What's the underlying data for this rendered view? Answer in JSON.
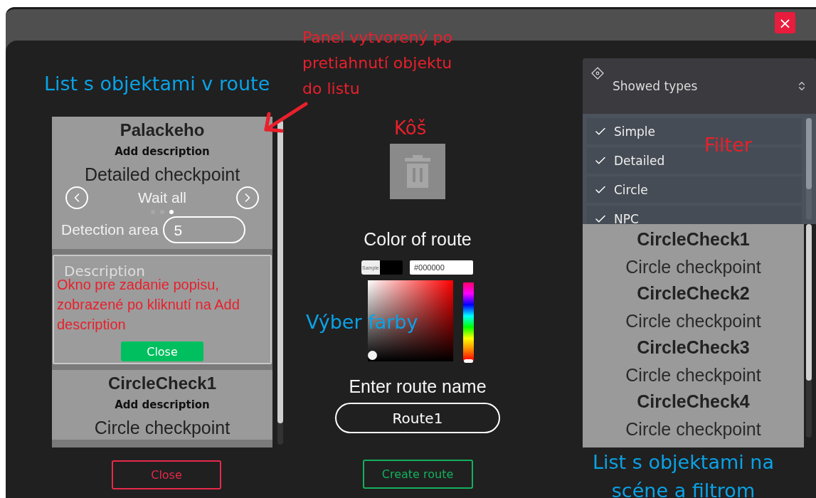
{
  "window": {
    "close_button": "×"
  },
  "route_list": {
    "items": [
      {
        "kind": "checkpoint",
        "name": "Palackeho",
        "description_link": "Add description",
        "type": "Detailed checkpoint",
        "mode": "Wait all",
        "mode_dots": [
          {
            "selected": false
          },
          {
            "selected": false
          },
          {
            "selected": true
          }
        ],
        "detection_label": "Detection area",
        "detection_value": "5"
      },
      {
        "kind": "description_editor",
        "placeholder": "Description",
        "close_button": "Close"
      },
      {
        "kind": "checkpoint",
        "name": "CircleCheck1",
        "description_link": "Add description",
        "type": "Circle checkpoint"
      }
    ],
    "close_button": "Close"
  },
  "color_picker": {
    "title": "Color of route",
    "sample_label": "Sample",
    "hex_value": "#000000",
    "hue_slider": {
      "level": 0
    }
  },
  "route_name": {
    "label": "Enter route name",
    "value": "Route1"
  },
  "create_button": "Create route",
  "filter": {
    "title": "Showed types",
    "options": [
      {
        "label": "Simple",
        "checked": true
      },
      {
        "label": "Detailed",
        "checked": true
      },
      {
        "label": "Circle",
        "checked": true
      },
      {
        "label": "NPC",
        "checked": true
      }
    ]
  },
  "scene_list": {
    "items": [
      {
        "name": "CircleCheck1",
        "type": "Circle checkpoint"
      },
      {
        "name": "CircleCheck2",
        "type": "Circle checkpoint"
      },
      {
        "name": "CircleCheck3",
        "type": "Circle checkpoint"
      },
      {
        "name": "CircleCheck4",
        "type": "Circle checkpoint"
      }
    ]
  },
  "annotations": [
    {
      "text": "List s objektami v route",
      "color": "#0aa2e6"
    },
    {
      "text": "Panel vytvorený po pretiahnutí objektu do listu",
      "color": "#e8202c"
    },
    {
      "text": "Kôš",
      "color": "#e8202c"
    },
    {
      "text": "Okno pre zadanie popisu, zobrazené po kliknutí na Add description",
      "color": "#e8202c"
    },
    {
      "text": "Výber farby",
      "color": "#0aa2e6"
    },
    {
      "text": "Filter",
      "color": "#e8202c"
    },
    {
      "text": "List s objektami na scéne a filtrom",
      "color": "#0aa2e6"
    }
  ]
}
